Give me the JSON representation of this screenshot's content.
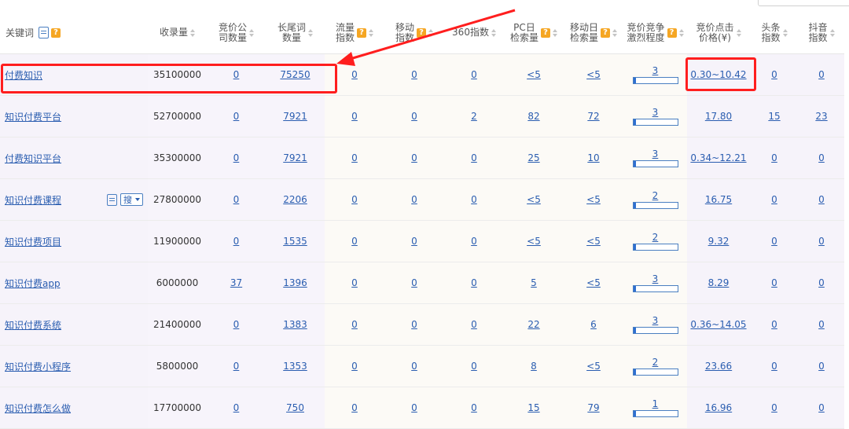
{
  "headers": {
    "keyword": "关键词",
    "volume": "收录量",
    "competitors": [
      "竞价公",
      "司数量"
    ],
    "longtail": [
      "长尾词",
      "数量"
    ],
    "traffic": [
      "流量",
      "指数"
    ],
    "mobile": [
      "移动",
      "指数"
    ],
    "idx360": "360指数",
    "pc": [
      "PC日",
      "检索量"
    ],
    "mobile_daily": [
      "移动日",
      "检索量"
    ],
    "competition": [
      "竞价竞争",
      "激烈程度"
    ],
    "bid_price": [
      "竞价点击",
      "价格(¥)"
    ],
    "toutiao": [
      "头条",
      "指数"
    ],
    "douyin": [
      "抖音",
      "指数"
    ],
    "help_icon_text": "?"
  },
  "rows": [
    {
      "keyword": "付费知识",
      "volume": "35100000",
      "competitors": "0",
      "longtail": "75250",
      "traffic": "0",
      "mobile": "0",
      "idx360": "0",
      "pc": "<5",
      "mobile_daily": "<5",
      "competition": "3",
      "bid": "0.30~10.42",
      "toutiao": "0",
      "douyin": "0"
    },
    {
      "keyword": "知识付费平台",
      "volume": "52700000",
      "competitors": "0",
      "longtail": "7921",
      "traffic": "0",
      "mobile": "0",
      "idx360": "2",
      "pc": "82",
      "mobile_daily": "72",
      "competition": "3",
      "bid": "17.80",
      "toutiao": "15",
      "douyin": "23"
    },
    {
      "keyword": "付费知识平台",
      "volume": "35300000",
      "competitors": "0",
      "longtail": "7921",
      "traffic": "0",
      "mobile": "0",
      "idx360": "0",
      "pc": "25",
      "mobile_daily": "10",
      "competition": "3",
      "bid": "0.34~12.21",
      "toutiao": "0",
      "douyin": "0"
    },
    {
      "keyword": "知识付费课程",
      "volume": "27800000",
      "competitors": "0",
      "longtail": "2206",
      "traffic": "0",
      "mobile": "0",
      "idx360": "0",
      "pc": "<5",
      "mobile_daily": "<5",
      "competition": "2",
      "bid": "16.75",
      "toutiao": "0",
      "douyin": "0"
    },
    {
      "keyword": "知识付费项目",
      "volume": "11900000",
      "competitors": "0",
      "longtail": "1535",
      "traffic": "0",
      "mobile": "0",
      "idx360": "0",
      "pc": "<5",
      "mobile_daily": "<5",
      "competition": "2",
      "bid": "9.32",
      "toutiao": "0",
      "douyin": "0"
    },
    {
      "keyword": "知识付费app",
      "volume": "6000000",
      "competitors": "37",
      "longtail": "1396",
      "traffic": "0",
      "mobile": "0",
      "idx360": "0",
      "pc": "5",
      "mobile_daily": "<5",
      "competition": "3",
      "bid": "8.29",
      "toutiao": "0",
      "douyin": "0"
    },
    {
      "keyword": "知识付费系统",
      "volume": "21400000",
      "competitors": "0",
      "longtail": "1383",
      "traffic": "0",
      "mobile": "0",
      "idx360": "0",
      "pc": "22",
      "mobile_daily": "6",
      "competition": "3",
      "bid": "0.36~14.05",
      "toutiao": "0",
      "douyin": "0"
    },
    {
      "keyword": "知识付费小程序",
      "volume": "5800000",
      "competitors": "0",
      "longtail": "1353",
      "traffic": "0",
      "mobile": "0",
      "idx360": "0",
      "pc": "8",
      "mobile_daily": "<5",
      "competition": "2",
      "bid": "23.66",
      "toutiao": "0",
      "douyin": "0"
    },
    {
      "keyword": "知识付费怎么做",
      "volume": "17700000",
      "competitors": "0",
      "longtail": "750",
      "traffic": "0",
      "mobile": "0",
      "idx360": "0",
      "pc": "15",
      "mobile_daily": "79",
      "competition": "1",
      "bid": "16.96",
      "toutiao": "0",
      "douyin": "0"
    }
  ],
  "row_tools": {
    "search_label": "搜"
  },
  "competition_max": 5,
  "colors": {
    "highlight": "#ff1e1e",
    "link": "#2a5db0",
    "bar": "#2e6fd1",
    "help": "#f5a623"
  }
}
